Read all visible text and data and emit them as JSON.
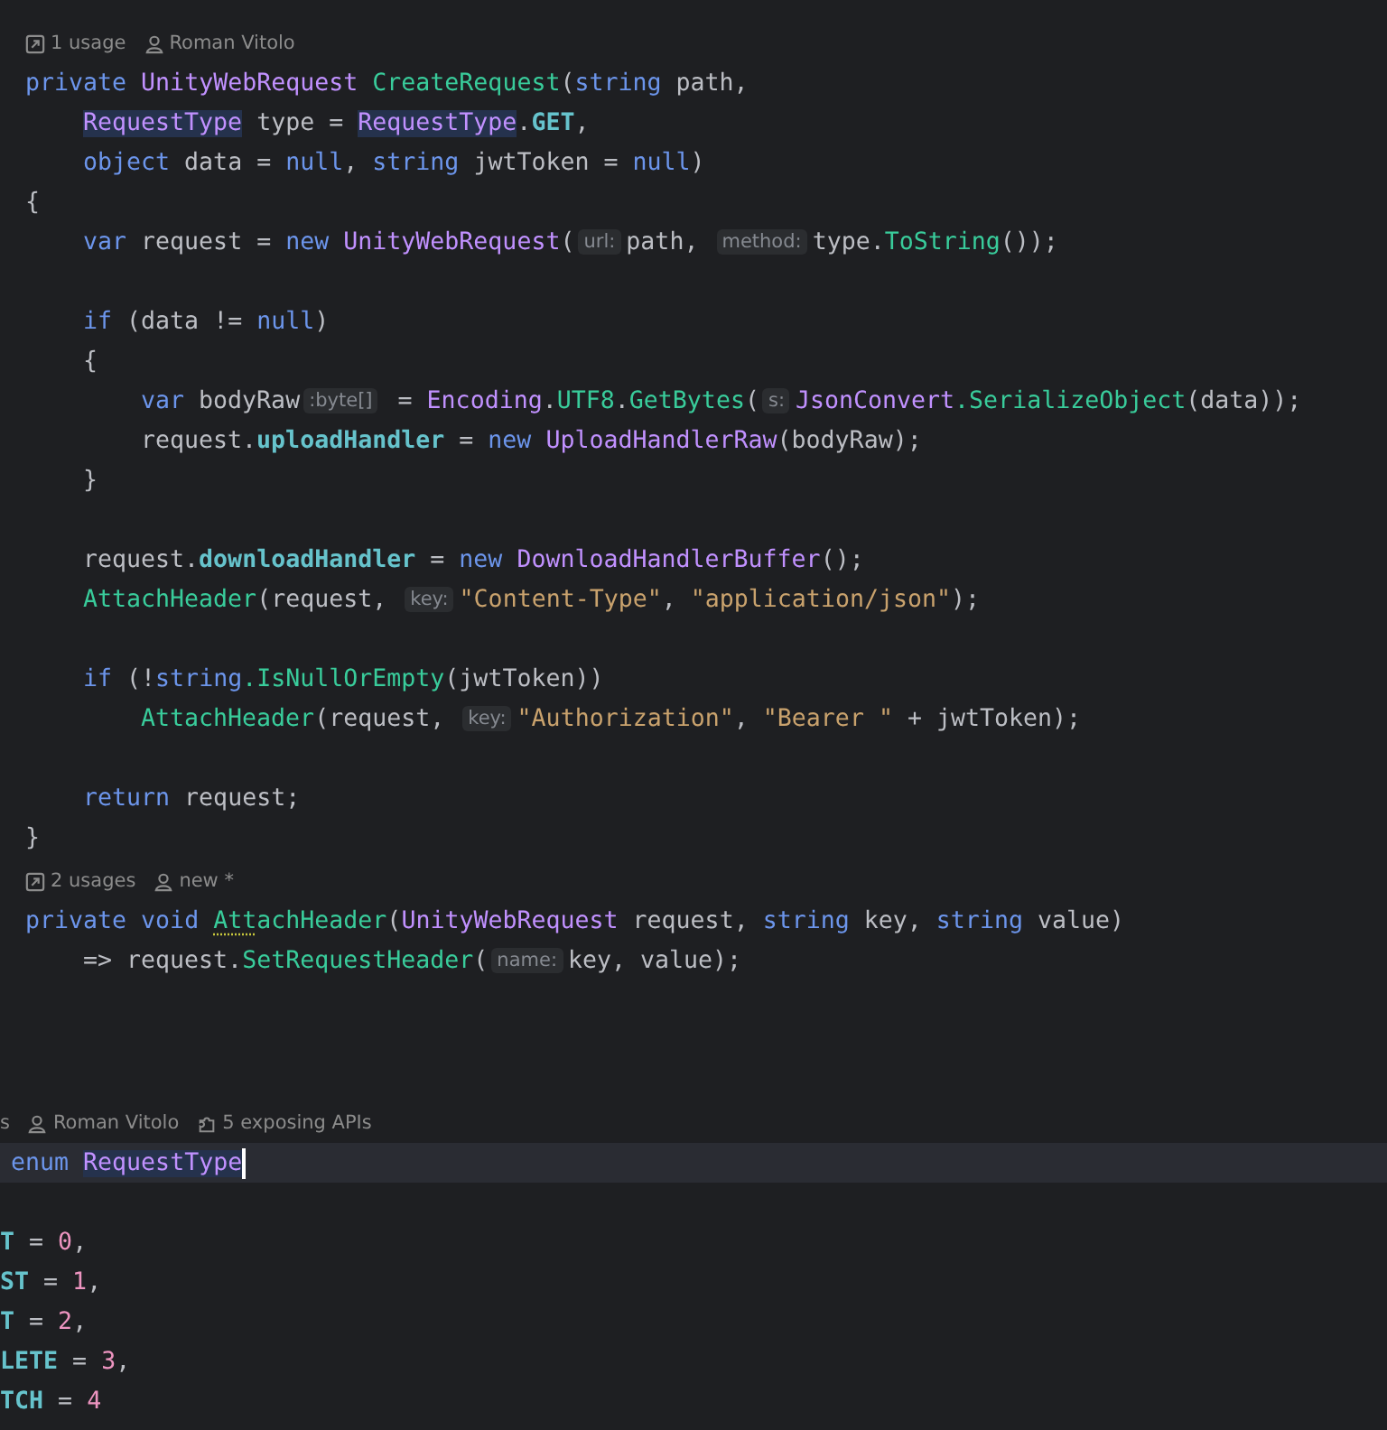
{
  "editor": {
    "sections": [
      {
        "shifted": false,
        "lines": [
          {
            "kind": "meta",
            "current": false,
            "items": [
              {
                "kind": "usages",
                "text": "1 usage"
              },
              {
                "kind": "author",
                "text": "Roman Vitolo"
              }
            ]
          },
          {
            "kind": "code",
            "current": false,
            "segs": [
              {
                "kind": "code",
                "tokens": [
                  {
                    "kind": "keyword",
                    "text": "private "
                  },
                  {
                    "kind": "type",
                    "text": "UnityWebRequest "
                  },
                  {
                    "kind": "method",
                    "text": "CreateRequest"
                  },
                  {
                    "kind": "plain",
                    "text": "("
                  },
                  {
                    "kind": "keyword",
                    "text": "string "
                  },
                  {
                    "kind": "plain",
                    "text": "path,"
                  }
                ]
              }
            ],
            "children": [
              {
                "kind": "code",
                "current": false,
                "segs": [
                  {
                    "kind": "code",
                    "tokens": [
                      {
                        "kind": "highlight",
                        "text": "RequestType"
                      },
                      {
                        "kind": "plain",
                        "text": " type = "
                      },
                      {
                        "kind": "highlight",
                        "text": "RequestType"
                      },
                      {
                        "kind": "plain",
                        "text": "."
                      },
                      {
                        "kind": "member",
                        "text": "GET"
                      },
                      {
                        "kind": "plain",
                        "text": ","
                      }
                    ]
                  }
                ]
              },
              {
                "kind": "code",
                "current": false,
                "segs": [
                  {
                    "kind": "code",
                    "tokens": [
                      {
                        "kind": "keyword",
                        "text": "object "
                      },
                      {
                        "kind": "plain",
                        "text": "data = "
                      },
                      {
                        "kind": "keyword",
                        "text": "null"
                      },
                      {
                        "kind": "plain",
                        "text": ", "
                      },
                      {
                        "kind": "keyword",
                        "text": "string "
                      },
                      {
                        "kind": "plain",
                        "text": "jwtToken = "
                      },
                      {
                        "kind": "keyword",
                        "text": "null"
                      },
                      {
                        "kind": "plain",
                        "text": ")"
                      }
                    ]
                  }
                ]
              }
            ]
          },
          {
            "kind": "code",
            "current": false,
            "segs": [
              {
                "kind": "code",
                "tokens": [
                  {
                    "kind": "plain",
                    "text": "{"
                  }
                ]
              }
            ],
            "children": [
              {
                "kind": "code",
                "current": false,
                "segs": [
                  {
                    "kind": "code",
                    "tokens": [
                      {
                        "kind": "keyword",
                        "text": "var "
                      },
                      {
                        "kind": "plain",
                        "text": "request = "
                      },
                      {
                        "kind": "keyword",
                        "text": "new "
                      },
                      {
                        "kind": "type",
                        "text": "UnityWebRequest"
                      },
                      {
                        "kind": "plain",
                        "text": "("
                      }
                    ]
                  },
                  {
                    "kind": "hint",
                    "text": "url:"
                  },
                  {
                    "kind": "code",
                    "tokens": [
                      {
                        "kind": "plain",
                        "text": "path, "
                      }
                    ]
                  },
                  {
                    "kind": "hint",
                    "text": "method:"
                  },
                  {
                    "kind": "code",
                    "tokens": [
                      {
                        "kind": "plain",
                        "text": "type."
                      },
                      {
                        "kind": "method",
                        "text": "ToString"
                      },
                      {
                        "kind": "plain",
                        "text": "());"
                      }
                    ]
                  }
                ]
              },
              {
                "kind": "blank",
                "current": false
              },
              {
                "kind": "code",
                "current": false,
                "segs": [
                  {
                    "kind": "code",
                    "tokens": [
                      {
                        "kind": "keyword",
                        "text": "if "
                      },
                      {
                        "kind": "plain",
                        "text": "(data != "
                      },
                      {
                        "kind": "keyword",
                        "text": "null"
                      },
                      {
                        "kind": "plain",
                        "text": ")"
                      }
                    ]
                  }
                ]
              },
              {
                "kind": "code",
                "current": false,
                "segs": [
                  {
                    "kind": "code",
                    "tokens": [
                      {
                        "kind": "plain",
                        "text": "{"
                      }
                    ]
                  }
                ],
                "children": [
                  {
                    "kind": "code",
                    "current": false,
                    "segs": [
                      {
                        "kind": "code",
                        "tokens": [
                          {
                            "kind": "keyword",
                            "text": "var "
                          },
                          {
                            "kind": "plain",
                            "text": "bodyRaw"
                          }
                        ]
                      },
                      {
                        "kind": "hint",
                        "text": ":byte[]"
                      },
                      {
                        "kind": "code",
                        "tokens": [
                          {
                            "kind": "plain",
                            "text": " = "
                          },
                          {
                            "kind": "type",
                            "text": "Encoding"
                          },
                          {
                            "kind": "plain",
                            "text": "."
                          },
                          {
                            "kind": "method",
                            "text": "UTF8"
                          },
                          {
                            "kind": "plain",
                            "text": "."
                          },
                          {
                            "kind": "method",
                            "text": "GetBytes"
                          },
                          {
                            "kind": "plain",
                            "text": "("
                          }
                        ]
                      },
                      {
                        "kind": "hint",
                        "text": "s:"
                      },
                      {
                        "kind": "code",
                        "tokens": [
                          {
                            "kind": "type",
                            "text": "JsonConvert"
                          },
                          {
                            "kind": "method",
                            "text": ".SerializeObject"
                          },
                          {
                            "kind": "plain",
                            "text": "(data));"
                          }
                        ]
                      }
                    ]
                  },
                  {
                    "kind": "code",
                    "current": false,
                    "segs": [
                      {
                        "kind": "code",
                        "tokens": [
                          {
                            "kind": "plain",
                            "text": "request."
                          },
                          {
                            "kind": "member",
                            "text": "uploadHandler"
                          },
                          {
                            "kind": "plain",
                            "text": " = "
                          },
                          {
                            "kind": "keyword",
                            "text": "new "
                          },
                          {
                            "kind": "type",
                            "text": "UploadHandlerRaw"
                          },
                          {
                            "kind": "plain",
                            "text": "(bodyRaw);"
                          }
                        ]
                      }
                    ]
                  }
                ]
              },
              {
                "kind": "code",
                "current": false,
                "segs": [
                  {
                    "kind": "code",
                    "tokens": [
                      {
                        "kind": "plain",
                        "text": "}"
                      }
                    ]
                  }
                ]
              },
              {
                "kind": "blank",
                "current": false
              },
              {
                "kind": "code",
                "current": false,
                "segs": [
                  {
                    "kind": "code",
                    "tokens": [
                      {
                        "kind": "plain",
                        "text": "request."
                      },
                      {
                        "kind": "member",
                        "text": "downloadHandler"
                      },
                      {
                        "kind": "plain",
                        "text": " = "
                      },
                      {
                        "kind": "keyword",
                        "text": "new "
                      },
                      {
                        "kind": "type",
                        "text": "DownloadHandlerBuffer"
                      },
                      {
                        "kind": "plain",
                        "text": "();"
                      }
                    ]
                  }
                ]
              },
              {
                "kind": "code",
                "current": false,
                "segs": [
                  {
                    "kind": "code",
                    "tokens": [
                      {
                        "kind": "method",
                        "text": "AttachHeader"
                      },
                      {
                        "kind": "plain",
                        "text": "(request, "
                      }
                    ]
                  },
                  {
                    "kind": "hint",
                    "text": "key:"
                  },
                  {
                    "kind": "code",
                    "tokens": [
                      {
                        "kind": "string",
                        "text": "\"Content-Type\""
                      },
                      {
                        "kind": "plain",
                        "text": ", "
                      },
                      {
                        "kind": "string",
                        "text": "\"application/json\""
                      },
                      {
                        "kind": "plain",
                        "text": ");"
                      }
                    ]
                  }
                ]
              },
              {
                "kind": "blank",
                "current": false
              },
              {
                "kind": "code",
                "current": false,
                "segs": [
                  {
                    "kind": "code",
                    "tokens": [
                      {
                        "kind": "keyword",
                        "text": "if "
                      },
                      {
                        "kind": "plain",
                        "text": "(!"
                      },
                      {
                        "kind": "keyword",
                        "text": "string"
                      },
                      {
                        "kind": "method",
                        "text": ".IsNullOrEmpty"
                      },
                      {
                        "kind": "plain",
                        "text": "(jwtToken))"
                      }
                    ]
                  }
                ],
                "children": [
                  {
                    "kind": "code",
                    "current": false,
                    "segs": [
                      {
                        "kind": "code",
                        "tokens": [
                          {
                            "kind": "method",
                            "text": "AttachHeader"
                          },
                          {
                            "kind": "plain",
                            "text": "(request, "
                          }
                        ]
                      },
                      {
                        "kind": "hint",
                        "text": "key:"
                      },
                      {
                        "kind": "code",
                        "tokens": [
                          {
                            "kind": "string",
                            "text": "\"Authorization\""
                          },
                          {
                            "kind": "plain",
                            "text": ", "
                          },
                          {
                            "kind": "string",
                            "text": "\"Bearer \""
                          },
                          {
                            "kind": "plain",
                            "text": " + jwtToken);"
                          }
                        ]
                      }
                    ]
                  }
                ]
              },
              {
                "kind": "blank",
                "current": false
              },
              {
                "kind": "code",
                "current": false,
                "segs": [
                  {
                    "kind": "code",
                    "tokens": [
                      {
                        "kind": "keyword",
                        "text": "return "
                      },
                      {
                        "kind": "plain",
                        "text": "request;"
                      }
                    ]
                  }
                ]
              }
            ]
          },
          {
            "kind": "code",
            "current": false,
            "segs": [
              {
                "kind": "code",
                "tokens": [
                  {
                    "kind": "plain",
                    "text": "}"
                  }
                ]
              }
            ]
          },
          {
            "kind": "meta",
            "current": false,
            "items": [
              {
                "kind": "usages",
                "text": "2 usages"
              },
              {
                "kind": "author",
                "text": "new *"
              }
            ]
          },
          {
            "kind": "code",
            "current": false,
            "segs": [
              {
                "kind": "code",
                "tokens": [
                  {
                    "kind": "keyword",
                    "text": "private "
                  },
                  {
                    "kind": "keyword",
                    "text": "void "
                  },
                  {
                    "kind": "warning",
                    "text": "Att"
                  },
                  {
                    "kind": "method",
                    "text": "achHeader"
                  },
                  {
                    "kind": "plain",
                    "text": "("
                  },
                  {
                    "kind": "type",
                    "text": "UnityWebRequest "
                  },
                  {
                    "kind": "plain",
                    "text": "request, "
                  },
                  {
                    "kind": "keyword",
                    "text": "string "
                  },
                  {
                    "kind": "plain",
                    "text": "key, "
                  },
                  {
                    "kind": "keyword",
                    "text": "string "
                  },
                  {
                    "kind": "plain",
                    "text": "value)"
                  }
                ]
              }
            ],
            "children": [
              {
                "kind": "code",
                "current": false,
                "segs": [
                  {
                    "kind": "code",
                    "tokens": [
                      {
                        "kind": "plain",
                        "text": "=> request."
                      },
                      {
                        "kind": "method",
                        "text": "SetRequestHeader"
                      },
                      {
                        "kind": "plain",
                        "text": "("
                      }
                    ]
                  },
                  {
                    "kind": "hint",
                    "text": "name:"
                  },
                  {
                    "kind": "code",
                    "tokens": [
                      {
                        "kind": "plain",
                        "text": "key, value);"
                      }
                    ]
                  }
                ]
              }
            ]
          },
          {
            "kind": "blank",
            "current": false
          },
          {
            "kind": "blank",
            "current": false
          },
          {
            "kind": "blank",
            "current": false
          }
        ]
      },
      {
        "shifted": true,
        "lines": [
          {
            "kind": "meta",
            "current": false,
            "items": [
              {
                "kind": "fragment",
                "text": "s"
              },
              {
                "kind": "author",
                "text": "Roman Vitolo"
              },
              {
                "kind": "apis",
                "text": "5 exposing APIs"
              }
            ]
          },
          {
            "kind": "code",
            "current": true,
            "segs": [
              {
                "kind": "code",
                "tokens": [
                  {
                    "kind": "keyword",
                    "text": "enum "
                  },
                  {
                    "kind": "highlight",
                    "text": "RequestType"
                  }
                ]
              }
            ]
          },
          {
            "kind": "blank",
            "current": false
          },
          {
            "kind": "code",
            "current": false,
            "segs": [
              {
                "kind": "code",
                "tokens": [
                  {
                    "kind": "member",
                    "text": "T"
                  },
                  {
                    "kind": "plain",
                    "text": " = "
                  },
                  {
                    "kind": "number",
                    "text": "0"
                  },
                  {
                    "kind": "plain",
                    "text": ","
                  }
                ]
              }
            ]
          },
          {
            "kind": "code",
            "current": false,
            "segs": [
              {
                "kind": "code",
                "tokens": [
                  {
                    "kind": "member",
                    "text": "ST"
                  },
                  {
                    "kind": "plain",
                    "text": " = "
                  },
                  {
                    "kind": "number",
                    "text": "1"
                  },
                  {
                    "kind": "plain",
                    "text": ","
                  }
                ]
              }
            ]
          },
          {
            "kind": "code",
            "current": false,
            "segs": [
              {
                "kind": "code",
                "tokens": [
                  {
                    "kind": "member",
                    "text": "T"
                  },
                  {
                    "kind": "plain",
                    "text": " = "
                  },
                  {
                    "kind": "number",
                    "text": "2"
                  },
                  {
                    "kind": "plain",
                    "text": ","
                  }
                ]
              }
            ]
          },
          {
            "kind": "code",
            "current": false,
            "segs": [
              {
                "kind": "code",
                "tokens": [
                  {
                    "kind": "member",
                    "text": "LETE"
                  },
                  {
                    "kind": "plain",
                    "text": " = "
                  },
                  {
                    "kind": "number",
                    "text": "3"
                  },
                  {
                    "kind": "plain",
                    "text": ","
                  }
                ]
              }
            ]
          },
          {
            "kind": "code",
            "current": false,
            "segs": [
              {
                "kind": "code",
                "tokens": [
                  {
                    "kind": "member",
                    "text": "TCH"
                  },
                  {
                    "kind": "plain",
                    "text": " = "
                  },
                  {
                    "kind": "number",
                    "text": "4"
                  }
                ]
              }
            ]
          }
        ]
      }
    ]
  }
}
